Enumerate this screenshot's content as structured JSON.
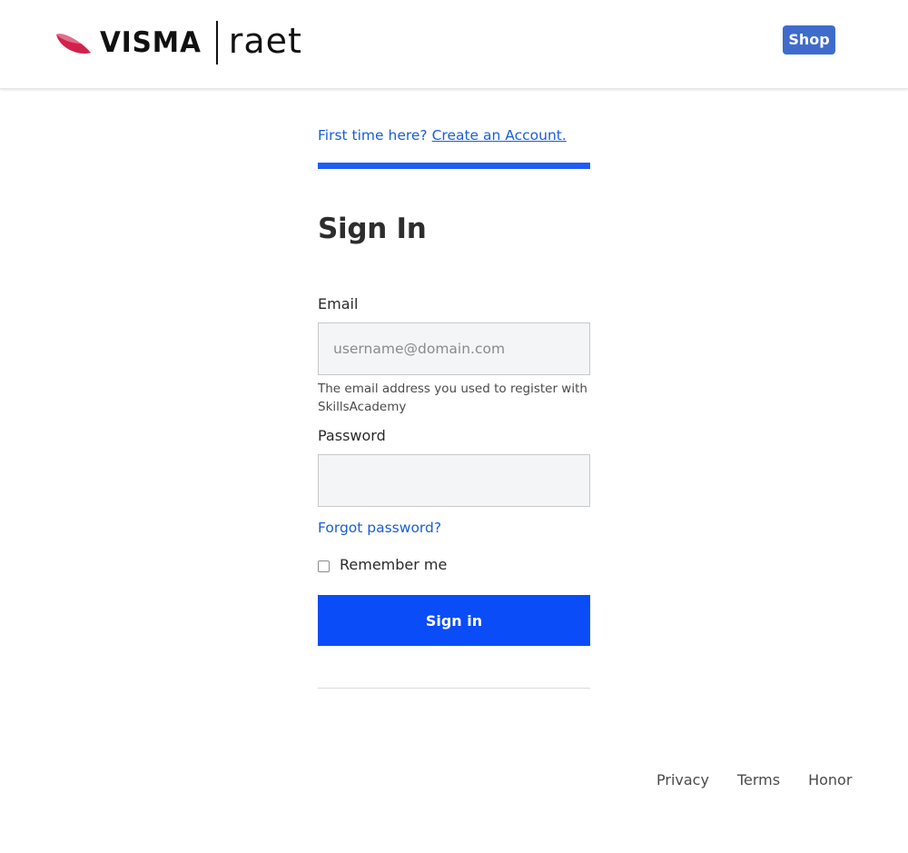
{
  "header": {
    "logo_brand": "VISMA",
    "logo_product": "raet",
    "shop_label": "Shop"
  },
  "signin": {
    "first_time_text": "First time here?",
    "create_account_link": "Create an Account.",
    "title": "Sign In",
    "email_label": "Email",
    "email_placeholder": "username@domain.com",
    "email_value": "",
    "email_help": "The email address you used to register with SkillsAcademy",
    "password_label": "Password",
    "password_value": "",
    "forgot_password": "Forgot password?",
    "remember_me": "Remember me",
    "remember_checked": false,
    "submit_label": "Sign in"
  },
  "footer": {
    "links": [
      "Privacy",
      "Terms",
      "Honor"
    ]
  },
  "colors": {
    "brand_red": "#d1224c",
    "shop_button": "#3f6ccb",
    "link": "#1a5dd8",
    "primary": "#0a4df8",
    "accent_bar": "#1f5cf5"
  }
}
